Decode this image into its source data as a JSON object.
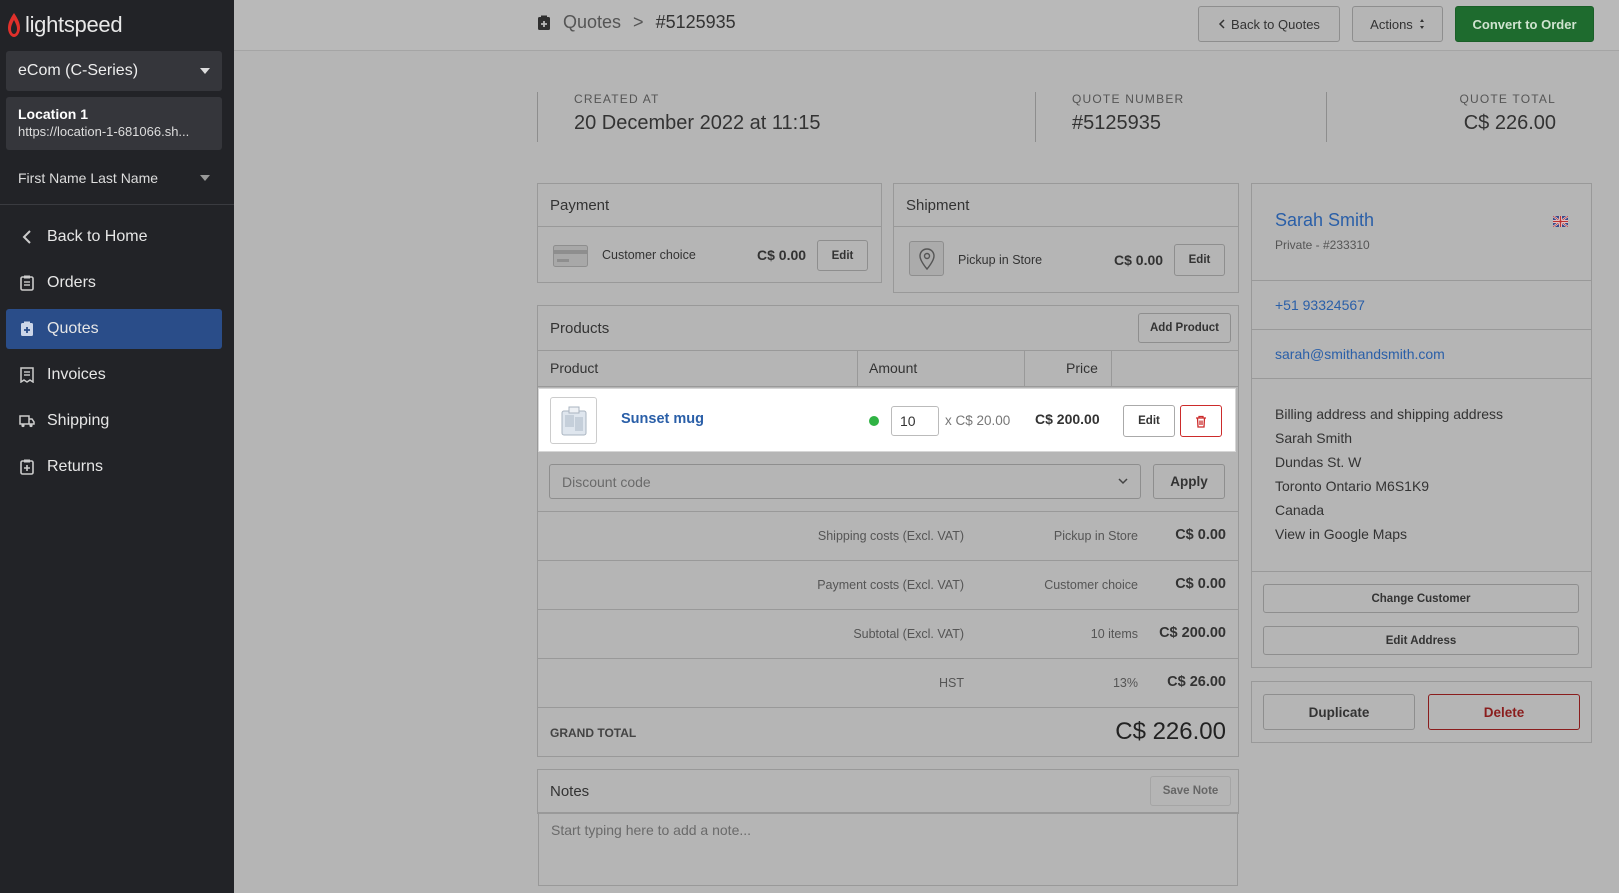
{
  "brand": {
    "name": "lightspeed",
    "flame_color": "#e0302b"
  },
  "sidebar": {
    "store": "eCom (C-Series)",
    "location_name": "Location 1",
    "location_url": "https://location-1-681066.sh...",
    "user": "First Name Last Name",
    "items": [
      {
        "label": "Back to Home",
        "icon": "chevron-left-icon"
      },
      {
        "label": "Orders",
        "icon": "clipboard-icon"
      },
      {
        "label": "Quotes",
        "icon": "quote-icon",
        "active": true
      },
      {
        "label": "Invoices",
        "icon": "invoice-icon"
      },
      {
        "label": "Shipping",
        "icon": "truck-icon"
      },
      {
        "label": "Returns",
        "icon": "return-icon"
      }
    ]
  },
  "header": {
    "breadcrumb_parent": "Quotes",
    "breadcrumb_sep": ">",
    "breadcrumb_current": "#5125935",
    "back_button": "Back to Quotes",
    "actions_button": "Actions",
    "convert_button": "Convert to Order"
  },
  "summary": {
    "created_label": "CREATED AT",
    "created_value": "20 December 2022 at 11:15",
    "number_label": "QUOTE NUMBER",
    "number_value": "#5125935",
    "total_label": "QUOTE TOTAL",
    "total_value": "C$ 226.00"
  },
  "payment": {
    "title": "Payment",
    "method": "Customer choice",
    "amount": "C$ 0.00",
    "edit": "Edit"
  },
  "shipment": {
    "title": "Shipment",
    "method": "Pickup in Store",
    "amount": "C$ 0.00",
    "edit": "Edit"
  },
  "products": {
    "title": "Products",
    "add_button": "Add Product",
    "columns": {
      "product": "Product",
      "amount": "Amount",
      "price": "Price"
    },
    "rows": [
      {
        "name": "Sunset mug",
        "qty": "10",
        "unit": "x C$ 20.00",
        "price": "C$ 200.00",
        "edit": "Edit",
        "in_stock": true
      }
    ],
    "discount_placeholder": "Discount code",
    "apply": "Apply"
  },
  "totals": [
    {
      "label": "Shipping costs (Excl. VAT)",
      "mid": "Pickup in Store",
      "value": "C$ 0.00"
    },
    {
      "label": "Payment costs (Excl. VAT)",
      "mid": "Customer choice",
      "value": "C$ 0.00"
    },
    {
      "label": "Subtotal (Excl. VAT)",
      "mid": "10 items",
      "value": "C$ 200.00"
    },
    {
      "label": "HST",
      "mid": "13%",
      "value": "C$ 26.00"
    }
  ],
  "grand_total": {
    "label": "GRAND TOTAL",
    "value": "C$ 226.00"
  },
  "notes": {
    "title": "Notes",
    "save": "Save Note",
    "placeholder": "Start typing here to add a note..."
  },
  "customer": {
    "name": "Sarah Smith",
    "meta": "Private - #233310",
    "phone": "+51 93324567",
    "email": "sarah@smithandsmith.com",
    "address_heading": "Billing address and shipping address",
    "address_lines": [
      "Sarah Smith",
      "Dundas St. W",
      "Toronto Ontario M6S1K9",
      "Canada"
    ],
    "maps_link": "View in Google Maps",
    "change_button": "Change Customer",
    "edit_address_button": "Edit Address",
    "duplicate_button": "Duplicate",
    "delete_button": "Delete"
  }
}
